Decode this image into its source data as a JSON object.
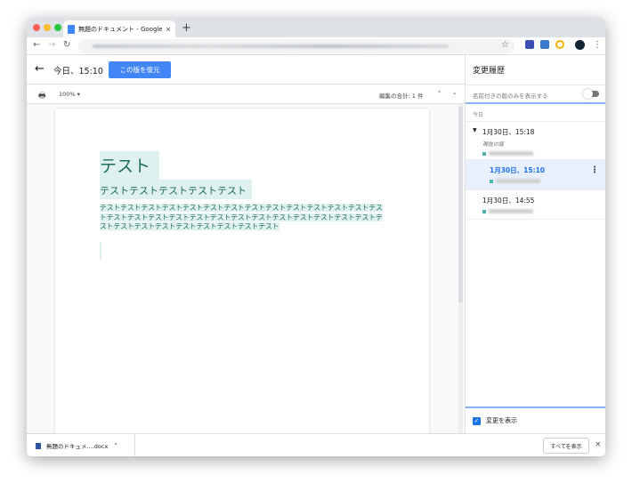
{
  "browser": {
    "tab_title": "無題のドキュメント - Google ドキュメント",
    "new_tab": "+",
    "tab_close": "×"
  },
  "header": {
    "title": "今日、15:10",
    "restore_button": "この版を復元"
  },
  "toolbar": {
    "zoom": "100%",
    "edits_total": "編集の合計: 1 件"
  },
  "document": {
    "heading": "テスト",
    "subtitle": "テストテストテストテストテスト",
    "body": "テストテストテストテストテストテストテストテストテストテストテストテストテストテストテストテストテストテストテストテストテストテストテストテストテストテストテストテストテストテストテストテストテストテストテストテスト"
  },
  "history": {
    "title": "変更履歴",
    "named_only": "名前付きの版のみを表示する",
    "named_only_on": false,
    "group": "今日",
    "versions": [
      {
        "time": "1月30日、15:18",
        "note": "現在の版",
        "selected": false,
        "expanded": true
      },
      {
        "time": "1月30日、15:10",
        "selected": true
      },
      {
        "time": "1月30日、14:55",
        "selected": false
      }
    ],
    "show_changes": "変更を表示",
    "show_changes_checked": true
  },
  "downloads": {
    "file": "無題のドキュメ....docx",
    "show_all": "すべてを表示"
  },
  "colors": {
    "accent": "#4285f4",
    "highlight": "#dff1ef",
    "selected_bg": "#e8f0fe"
  }
}
